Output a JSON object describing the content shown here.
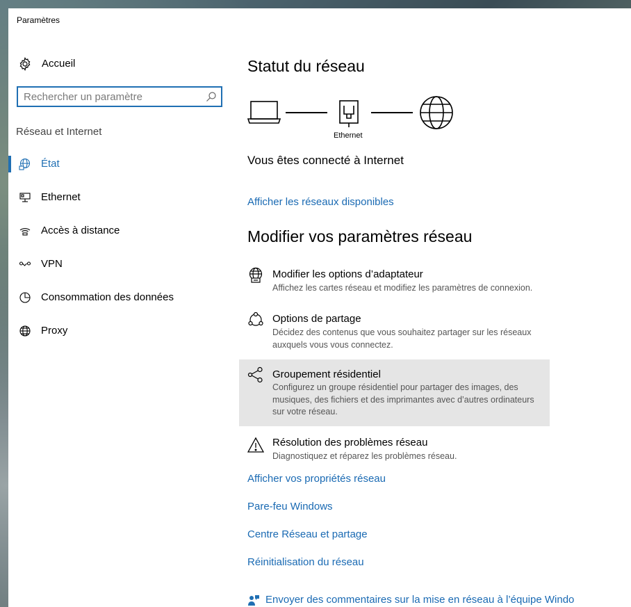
{
  "window": {
    "title": "Paramètres"
  },
  "sidebar": {
    "home_label": "Accueil",
    "search_placeholder": "Rechercher un paramètre",
    "section_label": "Réseau et Internet",
    "items": [
      {
        "label": "État",
        "icon": "globe-status-icon",
        "selected": true
      },
      {
        "label": "Ethernet",
        "icon": "ethernet-icon",
        "selected": false
      },
      {
        "label": "Accès à distance",
        "icon": "dialup-icon",
        "selected": false
      },
      {
        "label": "VPN",
        "icon": "vpn-icon",
        "selected": false
      },
      {
        "label": "Consommation des données",
        "icon": "pie-chart-icon",
        "selected": false
      },
      {
        "label": "Proxy",
        "icon": "globe-icon",
        "selected": false
      }
    ]
  },
  "main": {
    "heading_status": "Statut du réseau",
    "diagram_label": "Ethernet",
    "connected_text": "Vous êtes connecté à Internet",
    "link_available": "Afficher les réseaux disponibles",
    "heading_modify": "Modifier vos paramètres réseau",
    "options": [
      {
        "title": "Modifier les options d’adaptateur",
        "desc": "Affichez les cartes réseau et modifiez les paramètres de connexion.",
        "icon": "adapter-globe-icon"
      },
      {
        "title": "Options de partage",
        "desc": "Décidez des contenus que vous souhaitez partager sur les réseaux auxquels vous vous connectez.",
        "icon": "sharing-icon"
      },
      {
        "title": "Groupement résidentiel",
        "desc": "Configurez un groupe résidentiel pour partager des images, des musiques, des fichiers et des imprimantes avec d’autres ordinateurs sur votre réseau.",
        "icon": "homegroup-icon"
      },
      {
        "title": "Résolution des problèmes réseau",
        "desc": "Diagnostiquez et réparez les problèmes réseau.",
        "icon": "warning-icon"
      }
    ],
    "links": [
      "Afficher vos propriétés réseau",
      "Pare-feu Windows",
      "Centre Réseau et partage",
      "Réinitialisation du réseau"
    ],
    "feedback": "Envoyer des commentaires sur la mise en réseau à l’équipe Windows"
  },
  "colors": {
    "accent": "#1f6fb3",
    "link": "#1a6ab3",
    "hover": "#e5e5e5"
  }
}
